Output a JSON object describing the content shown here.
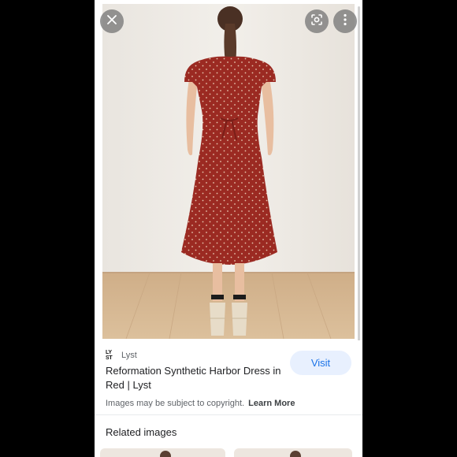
{
  "viewer": {
    "close_icon": "close-icon",
    "lens_icon": "google-lens-icon",
    "more_icon": "more-vert-icon"
  },
  "image": {
    "subject": "red polka dot midi dress, back view",
    "colors": {
      "dress": "#9b2a22",
      "wall": "#ece8e2",
      "floor": "#d8b994"
    }
  },
  "result": {
    "source_logo_top": "LY",
    "source_logo_bottom": "ST",
    "source_name": "Lyst",
    "title": "Reformation Synthetic Harbor Dress in Red | Lyst",
    "visit_label": "Visit",
    "copyright_text": "Images may be subject to copyright.",
    "learn_more_label": "Learn More"
  },
  "related": {
    "title": "Related images"
  },
  "colors": {
    "accent": "#1a73e8",
    "visit_bg": "#e8f0fe"
  }
}
